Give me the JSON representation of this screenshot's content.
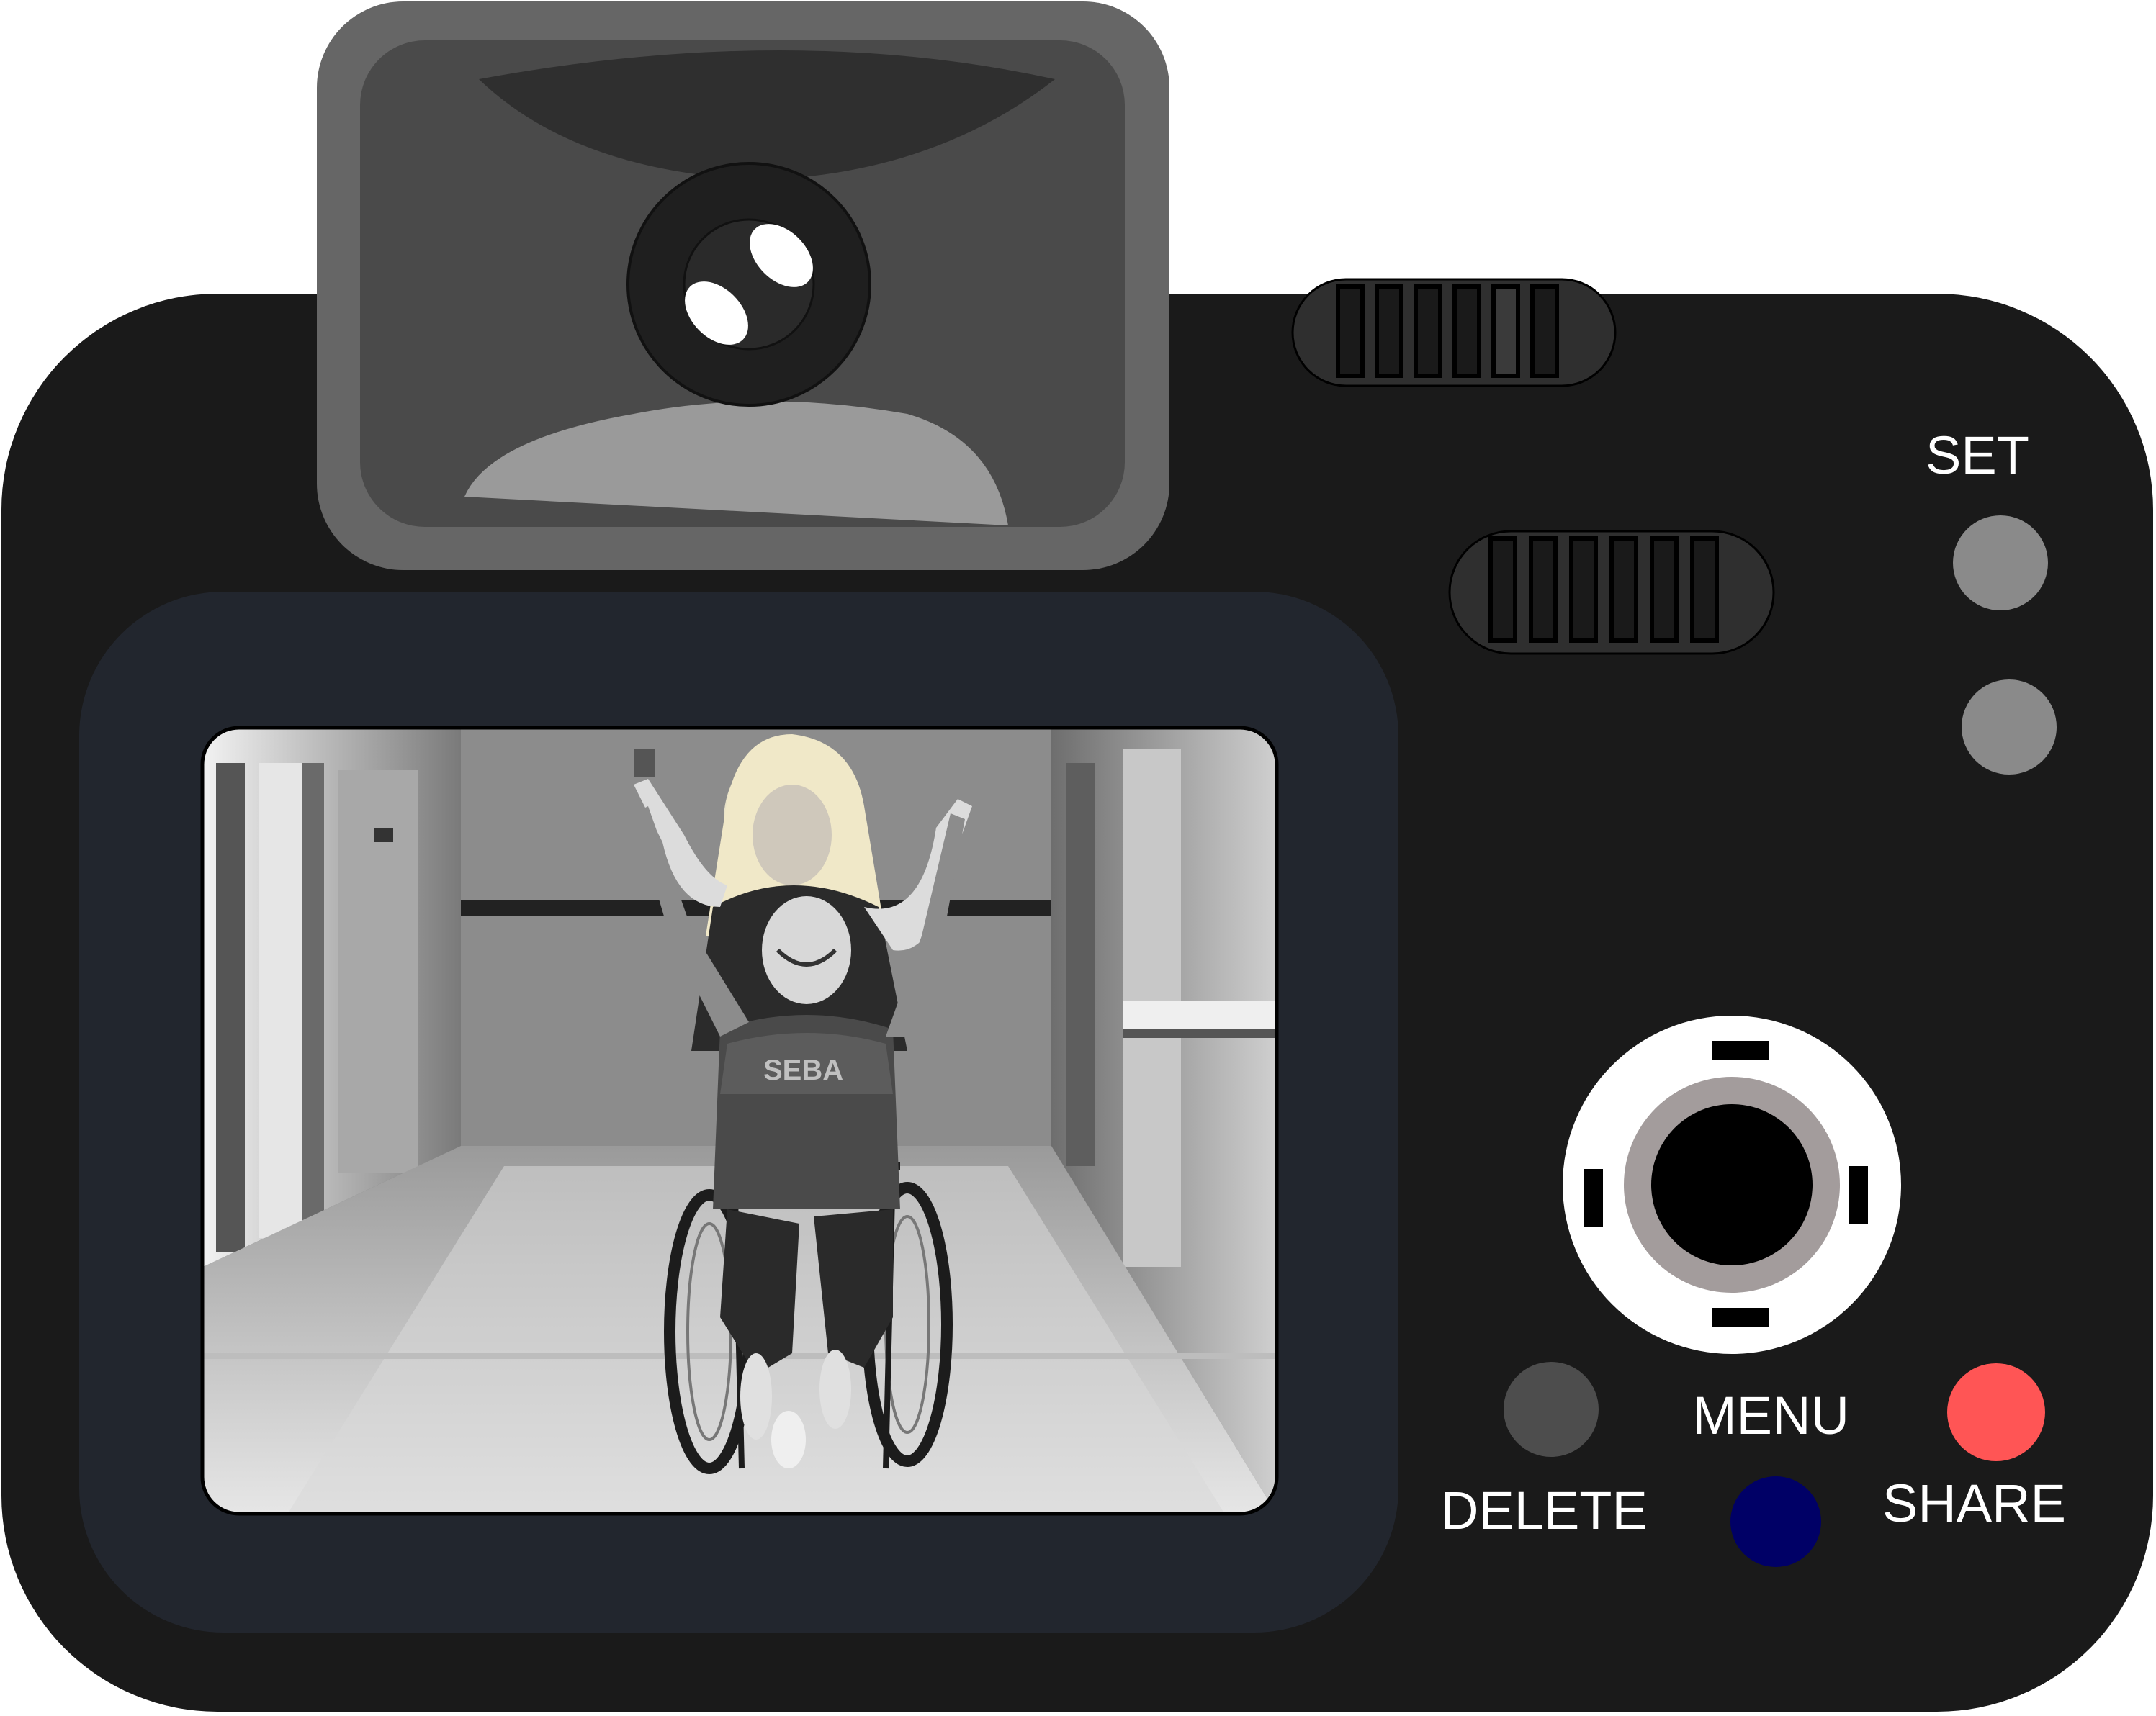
{
  "camera": {
    "body_color": "#1a1a1a",
    "screen_bezel_color": "#22262e",
    "viewfinder_color": "#666666",
    "controls": {
      "set_label": "SET",
      "menu_label": "MENU",
      "delete_label": "DELETE",
      "share_label": "SHARE"
    },
    "button_colors": {
      "set": "#8a8a8a",
      "secondary": "#8a8a8a",
      "delete": "#4d4d4d",
      "menu": "#000066",
      "share": "#ff5555"
    },
    "dpad": {
      "ring_color": "#ffffff",
      "inner_ring_color": "#a39c9c",
      "center_color": "#000000"
    },
    "screen": {
      "content": "grayscale-photo"
    }
  }
}
